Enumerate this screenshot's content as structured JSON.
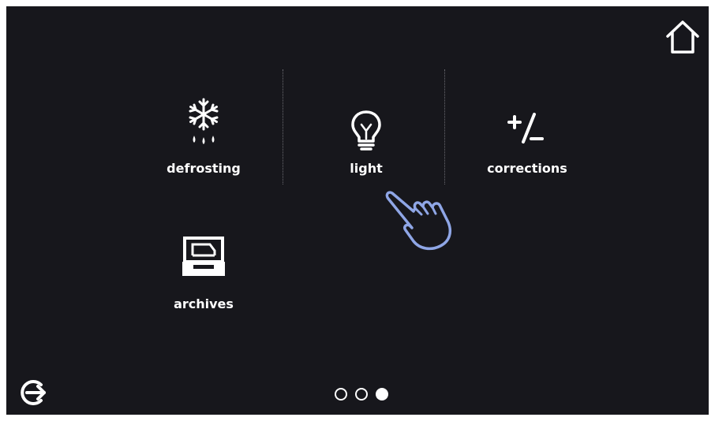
{
  "menu": {
    "items": [
      {
        "label": "defrosting",
        "icon": "snowflake-drops-icon"
      },
      {
        "label": "light",
        "icon": "light-bulb-icon"
      },
      {
        "label": "corrections",
        "icon": "plus-minus-icon"
      },
      {
        "label": "archives",
        "icon": "archive-tray-icon"
      }
    ]
  },
  "pagination": {
    "pages": 3,
    "current": 3
  },
  "colors": {
    "background": "#17171c",
    "foreground": "#ffffff",
    "hand_outline": "#8fa6e6"
  },
  "icons": {
    "home": "home-icon",
    "logout": "logout-icon",
    "hand": "pointing-hand-icon"
  }
}
